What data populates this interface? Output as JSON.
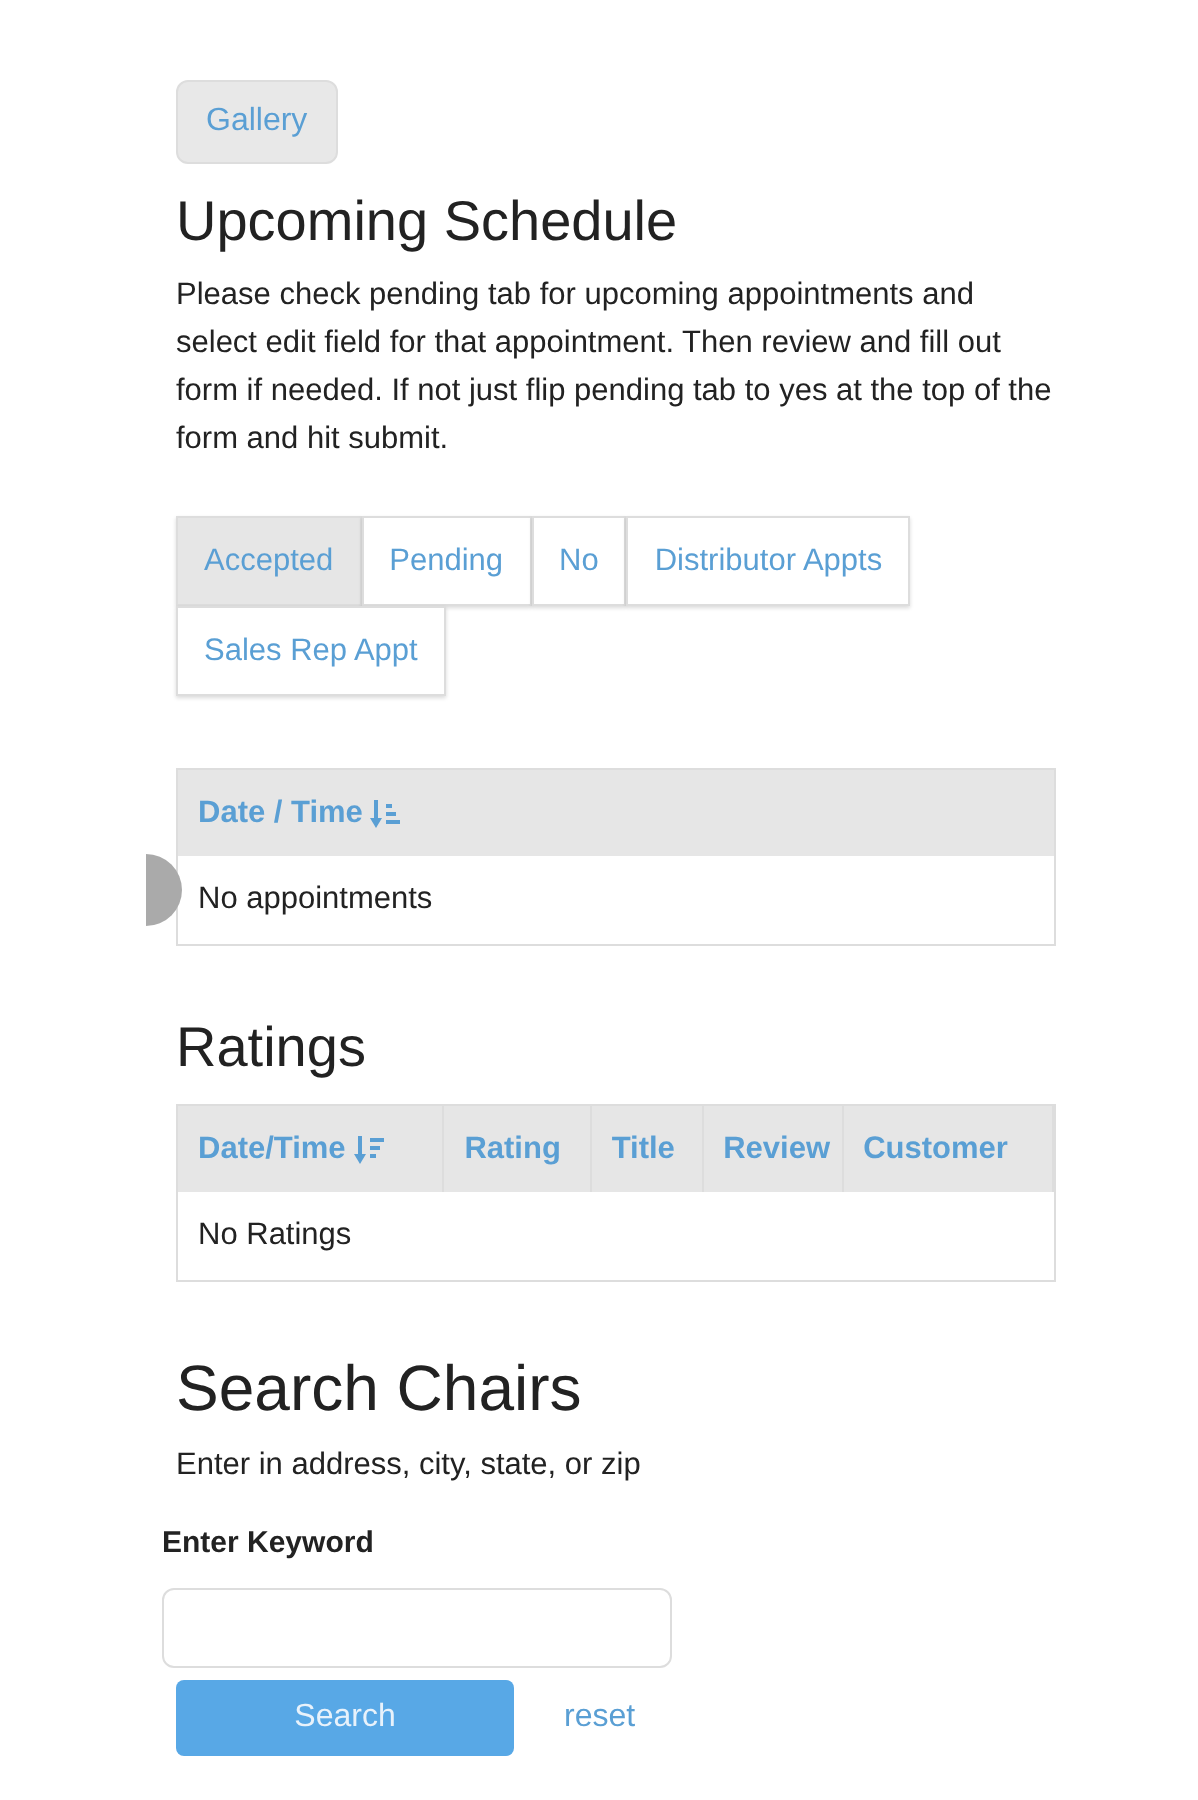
{
  "gallery_button": {
    "label": "Gallery"
  },
  "schedule": {
    "title": "Upcoming Schedule",
    "description": "Please check pending tab for upcoming appointments and select edit field for that appointment. Then review and fill out form if needed. If not just flip pending tab to yes at the top of the form and hit submit.",
    "tabs": [
      {
        "label": "Accepted",
        "selected": true
      },
      {
        "label": "Pending",
        "selected": false
      },
      {
        "label": "No",
        "selected": false
      },
      {
        "label": "Distributor Appts",
        "selected": false
      },
      {
        "label": "Sales Rep Appt",
        "selected": false
      }
    ],
    "table": {
      "columns": [
        "Date / Time"
      ],
      "empty_text": "No appointments"
    }
  },
  "ratings": {
    "title": "Ratings",
    "table": {
      "columns": [
        "Date/Time",
        "Rating",
        "Title",
        "Review",
        "Customer"
      ],
      "empty_text": "No Ratings"
    }
  },
  "search": {
    "title": "Search Chairs",
    "hint": "Enter in address, city, state, or zip",
    "field_label": "Enter Keyword",
    "button": "Search",
    "reset": "reset"
  }
}
